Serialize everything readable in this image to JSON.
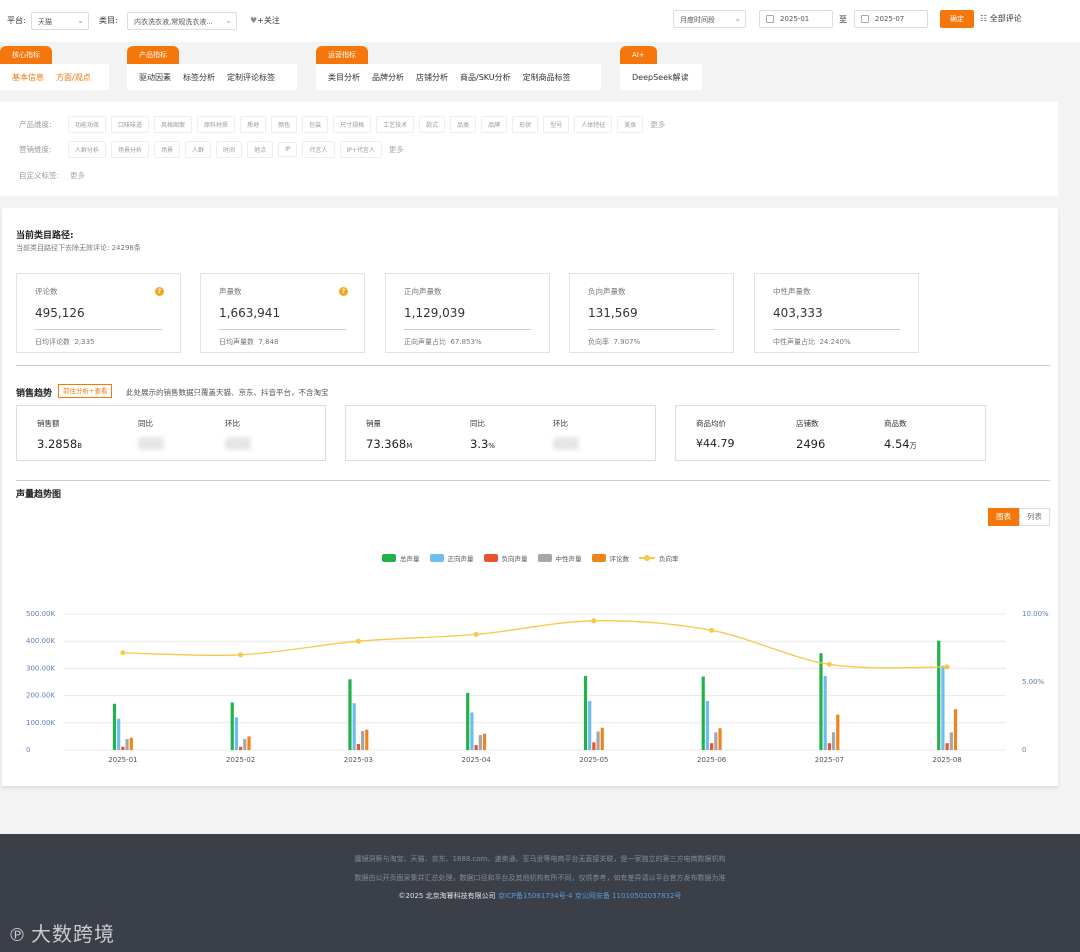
{
  "topbar": {
    "platform_label": "平台:",
    "platform_value": "天猫",
    "category_label": "类目:",
    "category_value": "内衣洗衣液,常规洗衣液...",
    "follow_label": "+关注",
    "period_value": "月度时间段",
    "date_start": "2025-01",
    "date_sep": "至",
    "date_end": "2025-07",
    "confirm_label": "确定",
    "all_reviews_label": "全部评论"
  },
  "groups": [
    {
      "tag": "核心指标",
      "items": [
        "基本信息",
        "方面/观点"
      ]
    },
    {
      "tag": "产品指标",
      "items": [
        "驱动因素",
        "标签分析",
        "定制评论标签"
      ]
    },
    {
      "tag": "运营指标",
      "items": [
        "类目分析",
        "品牌分析",
        "店铺分析",
        "商品/SKU分析",
        "定制商品标签"
      ]
    },
    {
      "tag": "AI+",
      "items": [
        "DeepSeek解读"
      ]
    }
  ],
  "dimensions": {
    "product_label": "产品维度:",
    "product_chips": [
      "功能功效",
      "口味味道",
      "风格图案",
      "原料材质",
      "质地",
      "颜色",
      "包装",
      "尺寸规格",
      "工艺技术",
      "款式",
      "品类",
      "品牌",
      "形状",
      "型号",
      "人体特征",
      "美食"
    ],
    "marketing_label": "营销维度:",
    "marketing_chips": [
      "人群分析",
      "场景分析",
      "场景",
      "人群",
      "时间",
      "地点",
      "IP",
      "代言人",
      "IP+代言人"
    ],
    "custom_label": "自定义标签:",
    "more_label": "更多"
  },
  "path": {
    "title": "当前类目路径:",
    "subtitle": "当前类目路径下去除无效评论: 24298条"
  },
  "stats": [
    {
      "label": "评论数",
      "value": "495,126",
      "sub_label": "日均评论数",
      "sub_value": "2,335",
      "help": true
    },
    {
      "label": "声量数",
      "value": "1,663,941",
      "sub_label": "日均声量数",
      "sub_value": "7,848",
      "help": true
    },
    {
      "label": "正向声量数",
      "value": "1,129,039",
      "sub_label": "正向声量占比",
      "sub_value": "67.853%",
      "help": false
    },
    {
      "label": "负向声量数",
      "value": "131,569",
      "sub_label": "负向率",
      "sub_value": "7.907%",
      "help": false
    },
    {
      "label": "中性声量数",
      "value": "403,333",
      "sub_label": "中性声量占比",
      "sub_value": "24.240%",
      "help": false
    }
  ],
  "sales": {
    "title": "销售趋势",
    "goto_label": "前往分析+查看",
    "note": "此处展示的销售数据只覆盖天猫、京东、抖音平台，不含淘宝",
    "box1": {
      "sales_label": "销售额",
      "sales_value": "3.2858",
      "sales_unit": "B",
      "yoy_label": "同比",
      "mom_label": "环比"
    },
    "box2": {
      "volume_label": "销量",
      "volume_value": "73.368",
      "volume_unit": "M",
      "yoy_label": "同比",
      "yoy_value": "3.3",
      "yoy_unit": "%",
      "mom_label": "环比"
    },
    "box3": {
      "price_label": "商品均价",
      "price_value": "¥44.79",
      "shops_label": "店铺数",
      "shops_value": "2496",
      "items_label": "商品数",
      "items_value": "4.54",
      "items_unit": "万"
    }
  },
  "volume_trend": {
    "title": "声量趋势图",
    "toggle_chart": "图表",
    "toggle_list": "列表"
  },
  "colors": {
    "accent": "#f5760a",
    "total": "#22b14c",
    "positive": "#6cbdf0",
    "negative": "#e8542c",
    "neutral": "#a6a6a6",
    "reviews": "#f0841c",
    "neg_rate": "#f7c948"
  },
  "chart_data": {
    "type": "bar",
    "categories": [
      "2025-01",
      "2025-02",
      "2025-03",
      "2025-04",
      "2025-05",
      "2025-06",
      "2025-07",
      "2025-08"
    ],
    "series": [
      {
        "name": "总声量",
        "values": [
          170000,
          175000,
          260000,
          210000,
          272000,
          270000,
          356000,
          402000
        ]
      },
      {
        "name": "正向声量",
        "values": [
          115000,
          120000,
          172000,
          138000,
          180000,
          180000,
          272000,
          310000
        ]
      },
      {
        "name": "负向声量",
        "values": [
          12000,
          12000,
          22000,
          18000,
          28000,
          25000,
          25000,
          25000
        ]
      },
      {
        "name": "中性声量",
        "values": [
          40000,
          40000,
          70000,
          55000,
          68000,
          65000,
          65000,
          65000
        ]
      },
      {
        "name": "评论数",
        "values": [
          45000,
          50000,
          75000,
          60000,
          82000,
          80000,
          130000,
          150000
        ]
      }
    ],
    "line_series": {
      "name": "负向率",
      "values": [
        7.15,
        7.0,
        8.0,
        8.5,
        9.5,
        8.8,
        6.3,
        6.1
      ]
    },
    "y_left_ticks": [
      "0",
      "100.00K",
      "200.00K",
      "300.00K",
      "400.00K",
      "500.00K"
    ],
    "y_right_ticks": [
      "0",
      "5.00%",
      "10.00%"
    ],
    "ylim": [
      0,
      500000
    ],
    "y2lim": [
      0,
      10
    ],
    "grid": true,
    "legend": "top-center"
  },
  "footer": {
    "line1": "魔镜洞察与淘宝、天猫、京东、1688.com、速卖通、亚马逊等电商平台无直接关联，是一家独立的第三方电商数据机构",
    "line2": "数据由公开页面采集并汇总处理，数据口径和平台及其他机构有所不同，仅供参考，如有差异请以平台官方发布数据为准",
    "copyright": "©2025 北京淘幂科技有限公司",
    "icp": "京ICP备15061734号-4",
    "police": "京公网安备 11010502037832号",
    "logo_text": "大数跨境"
  }
}
